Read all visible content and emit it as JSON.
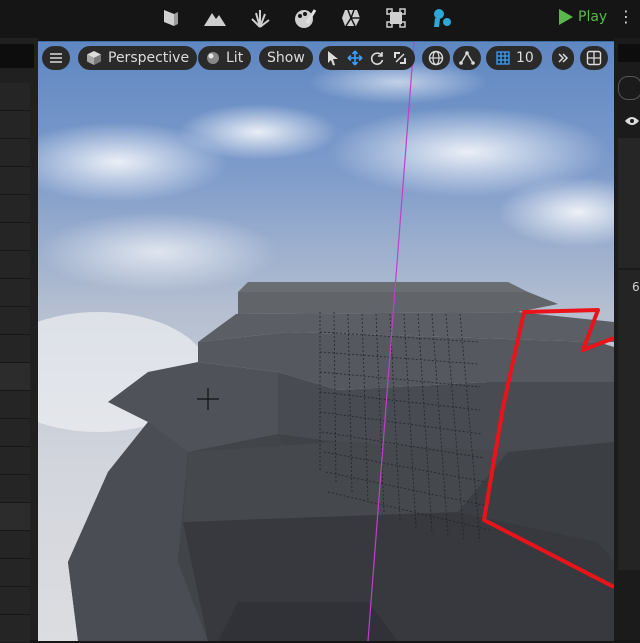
{
  "toolbar": {
    "icons": [
      "select-mode-icon",
      "landscape-icon",
      "foliage-icon",
      "mesh-paint-icon",
      "fracture-icon",
      "modeling-icon",
      "animation-icon"
    ],
    "play_label": "Play"
  },
  "viewport": {
    "menu_icon": "hamburger-menu-icon",
    "view_mode_label": "Perspective",
    "lighting_label": "Lit",
    "show_label": "Show",
    "transform_tools": [
      "select-arrow-icon",
      "move-icon",
      "rotate-icon",
      "scale-icon"
    ],
    "coordinate_icon": "globe-icon",
    "snap_icon": "surface-snap-icon",
    "grid_snap_value": "10",
    "more_icon": "double-chevron-icon",
    "layout_icon": "viewport-layout-icon"
  },
  "right_panel": {
    "visibility_icon": "eye-icon",
    "partial_text": "6"
  },
  "colors": {
    "sky_top": "#5f87c2",
    "sky_bottom": "#c8cdd6",
    "rock": "#4d5056",
    "selection": "#e8141a",
    "accent": "#58b94a"
  }
}
